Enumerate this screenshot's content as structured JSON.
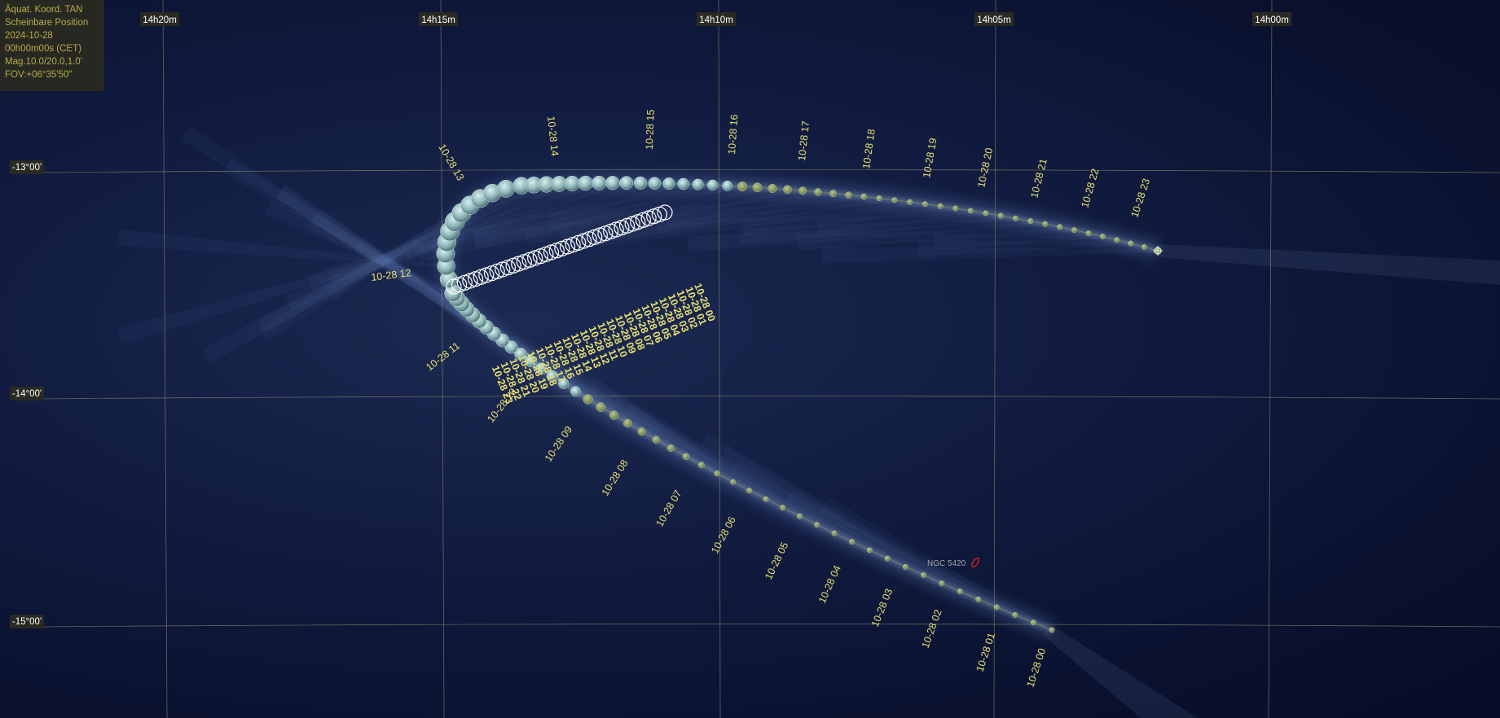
{
  "info_panel": {
    "lines": [
      "Äquat. Koord. TAN",
      "Scheinbare Position",
      "2024-10-28",
      "00h00m00s (CET)",
      "Mag.10.0/20.0,1.0'",
      "FOV:+06°35'50\""
    ]
  },
  "ra_labels": [
    "14h20m",
    "14h15m",
    "14h10m",
    "14h05m",
    "14h00m"
  ],
  "dec_labels": [
    "-13°00'",
    "-14°00'",
    "-15°00'"
  ],
  "track_labels": [
    "10-28 00",
    "10-28 01",
    "10-28 02",
    "10-28 03",
    "10-28 04",
    "10-28 05",
    "10-28 06",
    "10-28 07",
    "10-28 08",
    "10-28 09",
    "10-28 10",
    "10-28 11",
    "10-28 12",
    "10-28 13",
    "10-28 14",
    "10-28 15",
    "10-28 16",
    "10-28 17",
    "10-28 18",
    "10-28 19",
    "10-28 20",
    "10-28 21",
    "10-28 22",
    "10-28 23"
  ],
  "stacked_labels": [
    "10-28 00",
    "10-28 01",
    "10-28 02",
    "10-28 03",
    "10-28 04",
    "10-28 05",
    "10-28 06",
    "10-28 07",
    "10-28 08",
    "10-28 09",
    "10-28 10",
    "10-28 11",
    "10-28 12",
    "10-28 13",
    "10-28 14",
    "10-28 15",
    "10-28 16",
    "10-28 17",
    "10-28 18",
    "10-28 19",
    "10-28 20",
    "10-28 21",
    "10-28 22",
    "10-28 23"
  ],
  "object_label": "NGC 5420",
  "colors": {
    "label": "#e8e070",
    "grid": "#8a8a6a",
    "object": "#e02020",
    "grid_label_bg": "#2a2a22",
    "grid_label_text": "#ffffff"
  }
}
